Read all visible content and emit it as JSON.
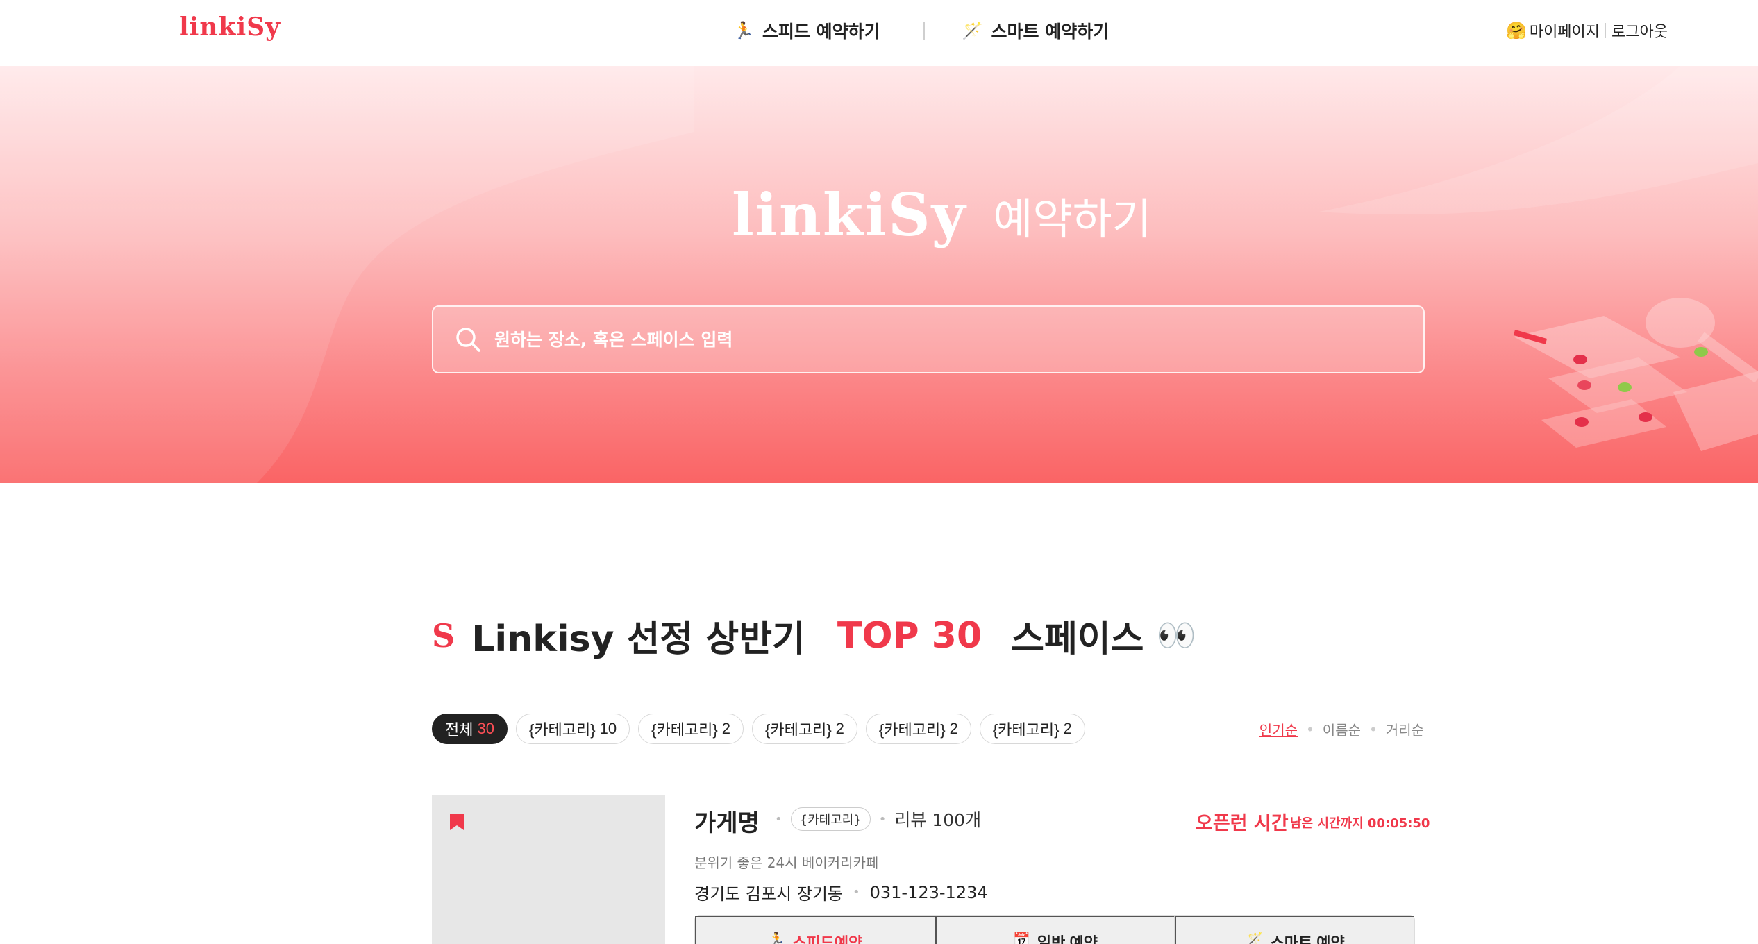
{
  "header": {
    "brand": "linkiSy",
    "nav": [
      {
        "icon": "running-icon",
        "glyph": "🏃",
        "label": "스피드 예약하기"
      },
      {
        "icon": "magic-wand-icon",
        "glyph": "🪄",
        "label": "스마트 예약하기"
      }
    ],
    "account": {
      "icon_glyph": "🤗",
      "mypage_label": "마이페이지",
      "logout_label": "로그아웃"
    }
  },
  "hero": {
    "logo": "linkiSy",
    "subtitle": "예약하기",
    "search_placeholder": "원하는 장소, 혹은 스페이스 입력"
  },
  "section": {
    "logo": "S",
    "title_before": "Linkisy 선정 상반기",
    "title_highlight": "TOP 30",
    "title_after": "스페이스",
    "eyes": "👀"
  },
  "filters": [
    {
      "label": "전체",
      "count": "30",
      "active": true
    },
    {
      "label": "{카테고리}",
      "count": "10"
    },
    {
      "label": "{카테고리}",
      "count": "2"
    },
    {
      "label": "{카테고리}",
      "count": "2"
    },
    {
      "label": "{카테고리}",
      "count": "2"
    },
    {
      "label": "{카테고리}",
      "count": "2"
    }
  ],
  "sort": {
    "popular": "인기순",
    "name": "이름순",
    "distance": "거리순",
    "active": "popular"
  },
  "card": {
    "name": "가게명",
    "category": "{카테고리}",
    "review": "리뷰 100개",
    "open_label": "오픈런 시간",
    "open_timer": "남은 시간까지 00:05:50",
    "description": "분위기 좋은 24시 베이커리카페",
    "address": "경기도 김포시 장기동",
    "phone": "031-123-1234",
    "buttons": [
      {
        "label": "스피드예약",
        "glyph": "🏃"
      },
      {
        "label": "일반 예약",
        "glyph": "📅"
      },
      {
        "label": "스마트 예약",
        "glyph": "🪄"
      }
    ]
  },
  "colors": {
    "accent": "#f0394b",
    "hero_bottom": "#fa6465",
    "hero_top": "#ffe9ea"
  }
}
